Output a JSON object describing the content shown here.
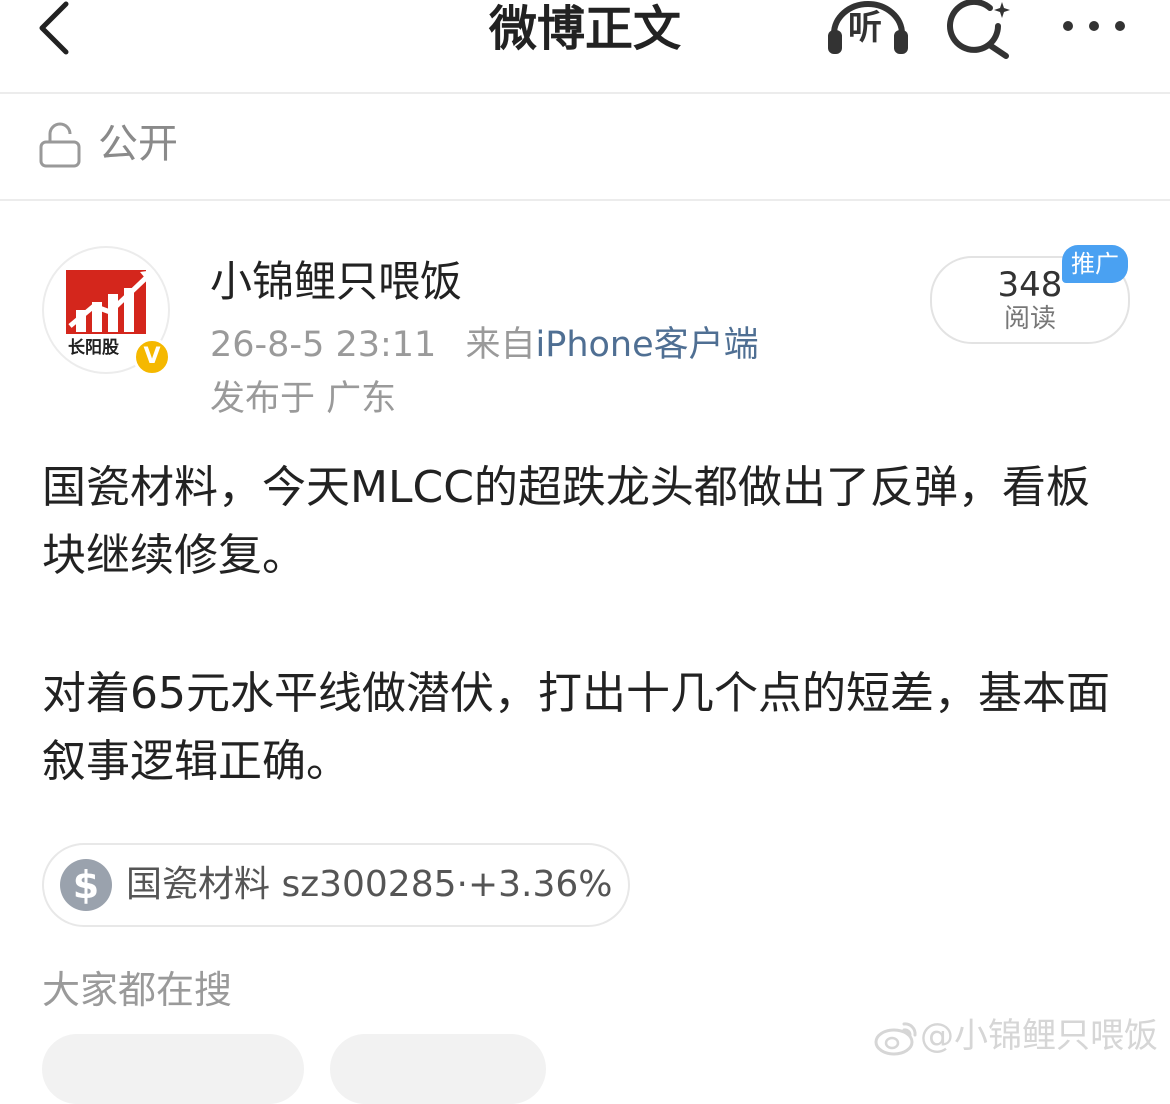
{
  "header": {
    "title": "微博正文",
    "listen_label": "听"
  },
  "privacy": {
    "label": "公开"
  },
  "post": {
    "author": {
      "name": "小锦鲤只喂饭",
      "avatar_text": "长阳股"
    },
    "verified_mark": "V",
    "time": "26-8-5 23:11",
    "source_prefix": "来自",
    "source": "iPhone客户端",
    "location": "发布于 广东",
    "reads": {
      "count": "348",
      "label": "阅读"
    },
    "promo_label": "推广",
    "paragraphs": [
      "国瓷材料，今天MLCC的超跌龙头都做出了反弹，看板块继续修复。",
      "对着65元水平线做潜伏，打出十几个点的短差，基本面叙事逻辑正确。"
    ],
    "stock_card": {
      "icon": "$",
      "text": "国瓷材料 sz300285·+3.36%"
    }
  },
  "search_section": {
    "label": "大家都在搜"
  },
  "watermark": "@小锦鲤只喂饭",
  "colors": {
    "link": "#4f6f93",
    "verified": "#f5b800",
    "promo": "#4aa1f2"
  }
}
